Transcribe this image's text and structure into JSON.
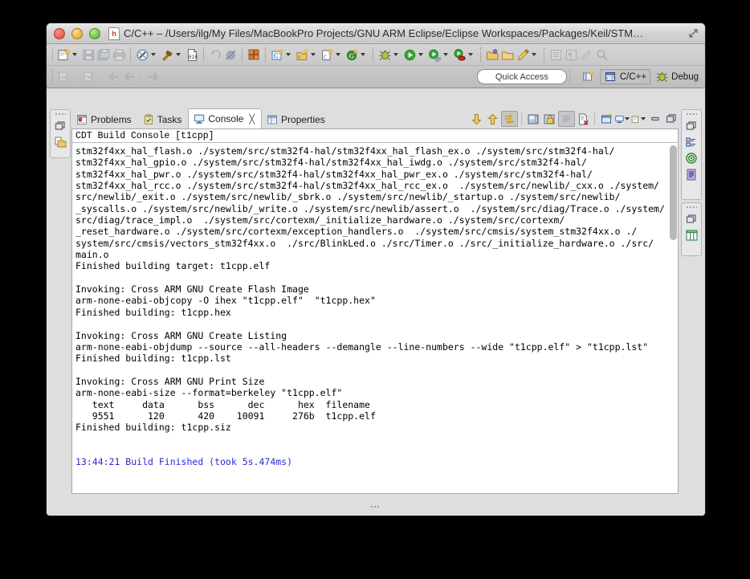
{
  "window": {
    "title": "C/C++ – /Users/ilg/My Files/MacBookPro Projects/GNU ARM Eclipse/Eclipse Workspaces/Packages/Keil/STM…",
    "app_icon_letter": "h"
  },
  "toolbar_primary": {
    "items": [
      {
        "name": "new-wizard-button",
        "icon": "new-file-icon",
        "dropdown": true,
        "enabled": true
      },
      {
        "name": "save-button",
        "icon": "save-icon",
        "dropdown": false,
        "enabled": false
      },
      {
        "name": "save-all-button",
        "icon": "save-all-icon",
        "dropdown": false,
        "enabled": false
      },
      {
        "name": "print-button",
        "icon": "print-icon",
        "dropdown": false,
        "enabled": false
      },
      {
        "name": "build-all-button",
        "icon": "build-all-icon",
        "dropdown": true,
        "enabled": true
      },
      {
        "name": "build-button",
        "icon": "hammer-icon",
        "dropdown": true,
        "enabled": true
      },
      {
        "name": "toggle-binary-button",
        "icon": "binary-file-icon",
        "dropdown": false,
        "enabled": true
      },
      {
        "name": "undo-button",
        "icon": "undo-icon",
        "dropdown": false,
        "enabled": false
      },
      {
        "name": "skip-breakpoints-button",
        "icon": "skip-breakpoints-icon",
        "dropdown": false,
        "enabled": false
      },
      {
        "name": "build-configurations-button",
        "icon": "blocks-icon",
        "dropdown": false,
        "enabled": true
      },
      {
        "name": "new-c-project-button",
        "icon": "new-c-folder-icon",
        "dropdown": true,
        "enabled": true
      },
      {
        "name": "new-cpp-class-button",
        "icon": "new-cpp-class-icon",
        "dropdown": true,
        "enabled": true
      },
      {
        "name": "new-c-file-button",
        "icon": "new-c-file-icon",
        "dropdown": true,
        "enabled": true
      },
      {
        "name": "git-repository-button",
        "icon": "git-icon",
        "dropdown": true,
        "enabled": true
      },
      {
        "name": "debug-button",
        "icon": "debug-bug-icon",
        "dropdown": true,
        "enabled": true
      },
      {
        "name": "run-button",
        "icon": "run-play-icon",
        "dropdown": true,
        "enabled": true
      },
      {
        "name": "run-history-button",
        "icon": "run-list-icon",
        "dropdown": true,
        "enabled": true
      },
      {
        "name": "external-tools-button",
        "icon": "external-tools-icon",
        "dropdown": true,
        "enabled": true
      },
      {
        "name": "open-resource-button",
        "icon": "open-folder-icon",
        "dropdown": false,
        "enabled": true
      },
      {
        "name": "open-type-button",
        "icon": "open-folder2-icon",
        "dropdown": false,
        "enabled": true
      },
      {
        "name": "search-marker-button",
        "icon": "pencil-icon",
        "dropdown": true,
        "enabled": true
      },
      {
        "name": "toggle-block-selection-button",
        "icon": "block-selection-icon",
        "dropdown": false,
        "enabled": false
      },
      {
        "name": "show-whitespace-button",
        "icon": "pilcrow-icon",
        "dropdown": false,
        "enabled": false
      },
      {
        "name": "annotation-button",
        "icon": "marker-icon",
        "dropdown": false,
        "enabled": false
      },
      {
        "name": "search-button",
        "icon": "search-icon",
        "dropdown": false,
        "enabled": false
      }
    ]
  },
  "toolbar_secondary": {
    "items": [
      {
        "name": "next-annotation-button",
        "icon": "next-annotation-icon",
        "dropdown": true,
        "enabled": false
      },
      {
        "name": "previous-annotation-button",
        "icon": "previous-annotation-icon",
        "dropdown": true,
        "enabled": false
      },
      {
        "name": "last-edit-location-button",
        "icon": "last-edit-location-icon",
        "dropdown": false,
        "enabled": false
      },
      {
        "name": "back-button",
        "icon": "back-arrow-icon",
        "dropdown": true,
        "enabled": false
      },
      {
        "name": "forward-button",
        "icon": "forward-arrow-icon",
        "dropdown": true,
        "enabled": false
      }
    ],
    "quick_access_placeholder": "Quick Access",
    "open-perspective": "open-perspective-icon",
    "perspectives": [
      {
        "label": "C/C++",
        "icon": "cpp-perspective-icon",
        "active": true
      },
      {
        "label": "Debug",
        "icon": "debug-perspective-icon",
        "active": false
      }
    ]
  },
  "left_trim_stack": {
    "items": [
      {
        "name": "restore-icon",
        "icon": "restore-icon"
      },
      {
        "name": "project-explorer-icon",
        "icon": "project-explorer-icon"
      }
    ]
  },
  "right_trim_stacks": [
    {
      "items": [
        {
          "name": "restore-icon",
          "icon": "restore-icon"
        },
        {
          "name": "outline-icon",
          "icon": "outline-icon"
        },
        {
          "name": "target-icon",
          "icon": "build-targets-icon"
        },
        {
          "name": "document-icon",
          "icon": "documents-icon"
        }
      ]
    },
    {
      "items": [
        {
          "name": "restore-icon",
          "icon": "restore-icon"
        },
        {
          "name": "task-list-icon",
          "icon": "task-list-icon"
        }
      ]
    }
  ],
  "view_tabs": [
    {
      "label": "Problems",
      "icon": "problems-icon",
      "active": false,
      "closable": false
    },
    {
      "label": "Tasks",
      "icon": "tasks-icon",
      "active": false,
      "closable": false
    },
    {
      "label": "Console",
      "icon": "console-icon",
      "active": true,
      "closable": true
    },
    {
      "label": "Properties",
      "icon": "properties-icon",
      "active": false,
      "closable": false
    }
  ],
  "view_toolbar": [
    {
      "name": "scroll-down-button",
      "icon": "down-arrow-icon",
      "pressed": false
    },
    {
      "name": "scroll-up-button",
      "icon": "up-arrow-icon",
      "pressed": false
    },
    {
      "name": "pin-console-button",
      "icon": "pin-console-icon",
      "pressed": true
    },
    {
      "name": "terminate-button",
      "icon": "terminate-icon",
      "pressed": false
    },
    {
      "name": "scroll-lock-button",
      "icon": "lock-icon",
      "pressed": false
    },
    {
      "name": "clear-console-button",
      "icon": "clear-console-icon",
      "pressed": false
    },
    {
      "name": "remove-console-button",
      "icon": "remove-console-icon",
      "pressed": false
    },
    {
      "name": "new-console-view-button",
      "icon": "new-console-view-icon",
      "pressed": false
    },
    {
      "name": "display-console-button",
      "icon": "display-console-icon",
      "pressed": false,
      "dropdown": true
    },
    {
      "name": "open-console-button",
      "icon": "open-console-icon",
      "pressed": false,
      "dropdown": true
    },
    {
      "name": "minimize-view-button",
      "icon": "minimize-icon",
      "pressed": false
    },
    {
      "name": "maximize-view-button",
      "icon": "maximize-icon",
      "pressed": false
    }
  ],
  "console": {
    "header": "CDT Build Console [t1cpp]",
    "lines": [
      {
        "text": "stm32f4xx_hal_flash.o ./system/src/stm32f4-hal/stm32f4xx_hal_flash_ex.o ./system/src/stm32f4-hal/",
        "color": "black"
      },
      {
        "text": "stm32f4xx_hal_gpio.o ./system/src/stm32f4-hal/stm32f4xx_hal_iwdg.o ./system/src/stm32f4-hal/",
        "color": "black"
      },
      {
        "text": "stm32f4xx_hal_pwr.o ./system/src/stm32f4-hal/stm32f4xx_hal_pwr_ex.o ./system/src/stm32f4-hal/",
        "color": "black"
      },
      {
        "text": "stm32f4xx_hal_rcc.o ./system/src/stm32f4-hal/stm32f4xx_hal_rcc_ex.o  ./system/src/newlib/_cxx.o ./system/",
        "color": "black"
      },
      {
        "text": "src/newlib/_exit.o ./system/src/newlib/_sbrk.o ./system/src/newlib/_startup.o ./system/src/newlib/",
        "color": "black"
      },
      {
        "text": "_syscalls.o ./system/src/newlib/_write.o ./system/src/newlib/assert.o  ./system/src/diag/Trace.o ./system/",
        "color": "black"
      },
      {
        "text": "src/diag/trace_impl.o  ./system/src/cortexm/_initialize_hardware.o ./system/src/cortexm/",
        "color": "black"
      },
      {
        "text": "_reset_hardware.o ./system/src/cortexm/exception_handlers.o  ./system/src/cmsis/system_stm32f4xx.o ./",
        "color": "black"
      },
      {
        "text": "system/src/cmsis/vectors_stm32f4xx.o  ./src/BlinkLed.o ./src/Timer.o ./src/_initialize_hardware.o ./src/",
        "color": "black"
      },
      {
        "text": "main.o",
        "color": "black"
      },
      {
        "text": "Finished building target: t1cpp.elf",
        "color": "black"
      },
      {
        "text": "",
        "color": "black"
      },
      {
        "text": "Invoking: Cross ARM GNU Create Flash Image",
        "color": "black"
      },
      {
        "text": "arm-none-eabi-objcopy -O ihex \"t1cpp.elf\"  \"t1cpp.hex\"",
        "color": "black"
      },
      {
        "text": "Finished building: t1cpp.hex",
        "color": "black"
      },
      {
        "text": "",
        "color": "black"
      },
      {
        "text": "Invoking: Cross ARM GNU Create Listing",
        "color": "black"
      },
      {
        "text": "arm-none-eabi-objdump --source --all-headers --demangle --line-numbers --wide \"t1cpp.elf\" > \"t1cpp.lst\"",
        "color": "black"
      },
      {
        "text": "Finished building: t1cpp.lst",
        "color": "black"
      },
      {
        "text": "",
        "color": "black"
      },
      {
        "text": "Invoking: Cross ARM GNU Print Size",
        "color": "black"
      },
      {
        "text": "arm-none-eabi-size --format=berkeley \"t1cpp.elf\"",
        "color": "black"
      },
      {
        "text": "   text\t   data\t    bss\t    dec\t    hex\tfilename",
        "color": "black"
      },
      {
        "text": "   9551\t    120\t    420\t  10091\t   276b\tt1cpp.elf",
        "color": "black"
      },
      {
        "text": "Finished building: t1cpp.siz",
        "color": "black"
      },
      {
        "text": "",
        "color": "black"
      },
      {
        "text": "",
        "color": "black"
      },
      {
        "text": "13:44:21 Build Finished (took 5s.474ms)",
        "color": "blue"
      }
    ],
    "size_table": {
      "headers": [
        "text",
        "data",
        "bss",
        "dec",
        "hex",
        "filename"
      ],
      "row": [
        "9551",
        "120",
        "420",
        "10091",
        "276b",
        "t1cpp.elf"
      ]
    },
    "build_finished": {
      "time": "13:44:21",
      "message": "Build Finished (took 5s.474ms)"
    }
  },
  "colors": {
    "accent_blue": "#2a2ad0",
    "window_chrome": "#d3d3d3",
    "console_bg": "#ffffff"
  }
}
